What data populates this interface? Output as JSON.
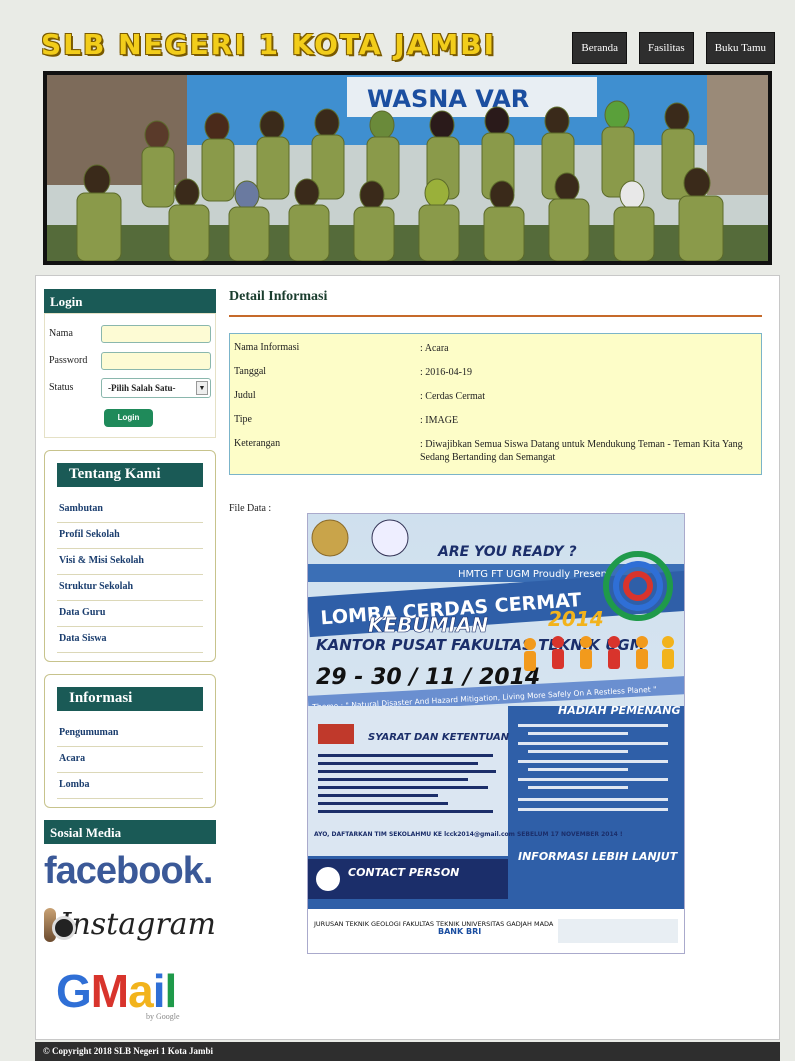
{
  "header": {
    "site_title": "SLB NEGERI 1 KOTA JAMBI",
    "nav": [
      "Beranda",
      "Fasilitas",
      "Buku Tamu"
    ]
  },
  "banner": {
    "sign_text": "WASNA VAR"
  },
  "login": {
    "title": "Login",
    "nama_label": "Nama",
    "password_label": "Password",
    "status_label": "Status",
    "status_value": "-Pilih Salah Satu-",
    "button": "Login"
  },
  "tentang": {
    "title": "Tentang Kami",
    "items": [
      "Sambutan",
      "Profil Sekolah",
      "Visi & Misi Sekolah",
      "Struktur Sekolah",
      "Data Guru",
      "Data Siswa"
    ]
  },
  "informasi": {
    "title": "Informasi",
    "items": [
      "Pengumuman",
      "Acara",
      "Lomba"
    ]
  },
  "social": {
    "title": "Sosial Media",
    "facebook": "facebook.",
    "instagram": "Instagram",
    "gmail": "Gmail",
    "gmail_by": "by Google"
  },
  "detail": {
    "title": "Detail Informasi",
    "rows": [
      {
        "k": "Nama Informasi",
        "v": ": Acara"
      },
      {
        "k": "Tanggal",
        "v": ": 2016-04-19"
      },
      {
        "k": "Judul",
        "v": ": Cerdas Cermat"
      },
      {
        "k": "Tipe",
        "v": ": IMAGE"
      },
      {
        "k": "Keterangan",
        "v": ": Diwajibkan Semua Siswa Datang untuk Mendukung Teman - Teman Kita Yang Sedang Bertanding dan Semangat"
      }
    ],
    "file_label": "File Data :"
  },
  "poster": {
    "ready": "ARE YOU READY ?",
    "hmtg": "HMTG FT UGM Proudly Present",
    "lomba": "LOMBA CERDAS CERMAT",
    "kebumian": "KEBUMIAN",
    "year": "2014",
    "kantor": "KANTOR PUSAT FAKULTAS TEKNIK UGM",
    "date": "29 - 30 / 11 / 2014",
    "theme": "Theme : \" Natural Disaster And Hazard Mitigation, Living More Safely On A Restless Planet \"",
    "hadiah": "HADIAH PEMENANG",
    "syarat": "SYARAT DAN KETENTUAN",
    "info": "INFORMASI LEBIH LANJUT",
    "contact": "CONTACT PERSON",
    "daftar": "AYO, DAFTARKAN TIM SEKOLAHMU KE lcck2014@gmail.com SEBELUM 17 NOVEMBER 2014 !",
    "jurusan": "JURUSAN TEKNIK GEOLOGI FAKULTAS TEKNIK UNIVERSITAS GADJAH MADA",
    "bank": "BANK BRI"
  },
  "footer": {
    "text": "© Copyright 2018 SLB Negeri 1 Kota Jambi"
  },
  "colors": {
    "accent": "#1a5a56",
    "title_yellow": "#f2cd1b",
    "nav_bg": "#2e2e2e",
    "info_bg": "#fdfdc8"
  }
}
